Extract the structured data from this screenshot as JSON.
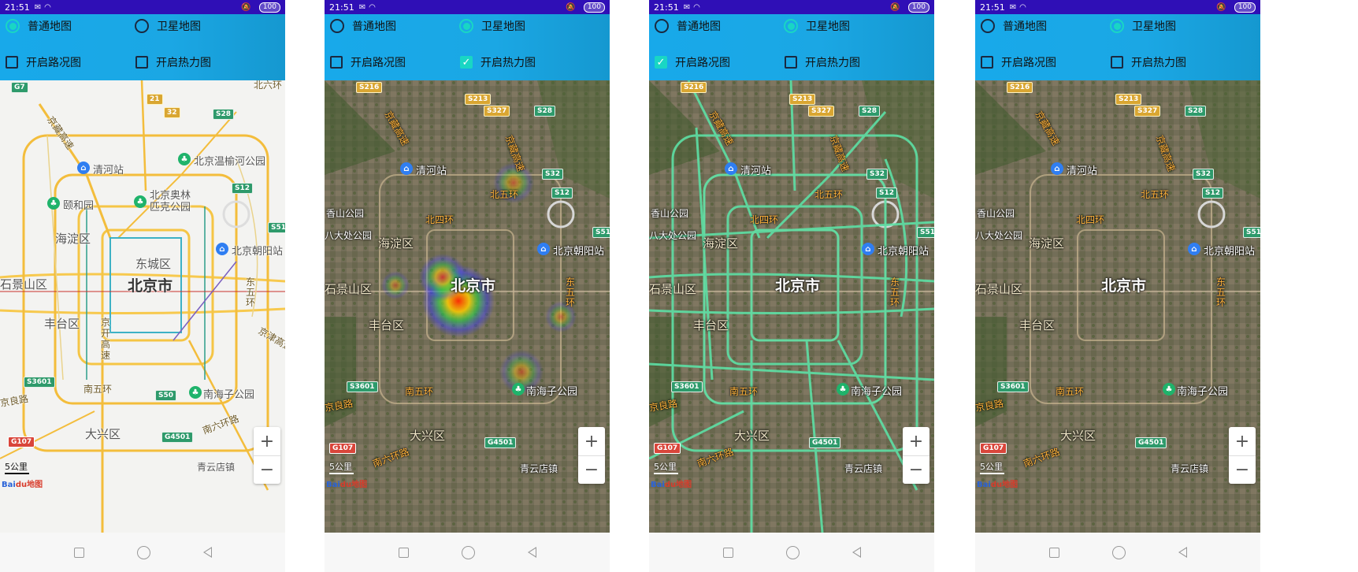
{
  "status_bar": {
    "time": "21:51",
    "battery": "100"
  },
  "options": {
    "normal_map": "普通地图",
    "satellite_map": "卫星地图",
    "traffic": "开启路况图",
    "heatmap": "开启热力图"
  },
  "screens": [
    {
      "mode": "normal",
      "normal_selected": true,
      "satellite_selected": false,
      "traffic_checked": false,
      "heatmap_checked": false
    },
    {
      "mode": "satellite",
      "normal_selected": false,
      "satellite_selected": true,
      "traffic_checked": false,
      "heatmap_checked": true
    },
    {
      "mode": "satellite",
      "normal_selected": false,
      "satellite_selected": true,
      "traffic_checked": true,
      "heatmap_checked": false
    },
    {
      "mode": "satellite",
      "normal_selected": false,
      "satellite_selected": true,
      "traffic_checked": false,
      "heatmap_checked": false
    }
  ],
  "map_labels": {
    "city": "北京市",
    "haidian": "海淀区",
    "dongcheng": "东城区",
    "fengtai": "丰台区",
    "daxing": "大兴区",
    "shijingshan": "石景山区",
    "qinghe": "清河站",
    "olympic": "北京奥林匹克公园",
    "wenyu": "北京温榆河公园",
    "yiheyuan": "颐和园",
    "chaoyang_station": "北京朝阳站",
    "nanhaizi": "南海子公园",
    "xiangshan": "香山公园",
    "badachu": "八大处公园",
    "qingyundian": "青云店镇",
    "jingzang": "京藏高速",
    "jingkai": "京开高速",
    "east5": "东五环",
    "south5": "南五环",
    "north5": "北五环",
    "north4": "北四环",
    "south6": "南六环路",
    "jingjin": "京津高速",
    "jingliang": "京良路",
    "beiliu": "北六环"
  },
  "shields": {
    "g7": "G7",
    "s216": "S216",
    "s213": "S213",
    "s327": "S327",
    "s28": "S28",
    "s32": "S32",
    "s12": "S12",
    "s51": "S51",
    "s3601": "S3601",
    "s50": "S50",
    "g4501": "G4501",
    "g107": "G107",
    "s21": "21",
    "s32b": "32"
  },
  "zoom": {
    "in": "+",
    "out": "−"
  },
  "scale": "5公里",
  "logo": {
    "a": "Bai",
    "b": "du地图"
  },
  "colors": {
    "status_bar": "#2f0fb6",
    "panel": "#18a9ea",
    "accent": "#19d6c4",
    "traffic": "#5de0a5"
  }
}
